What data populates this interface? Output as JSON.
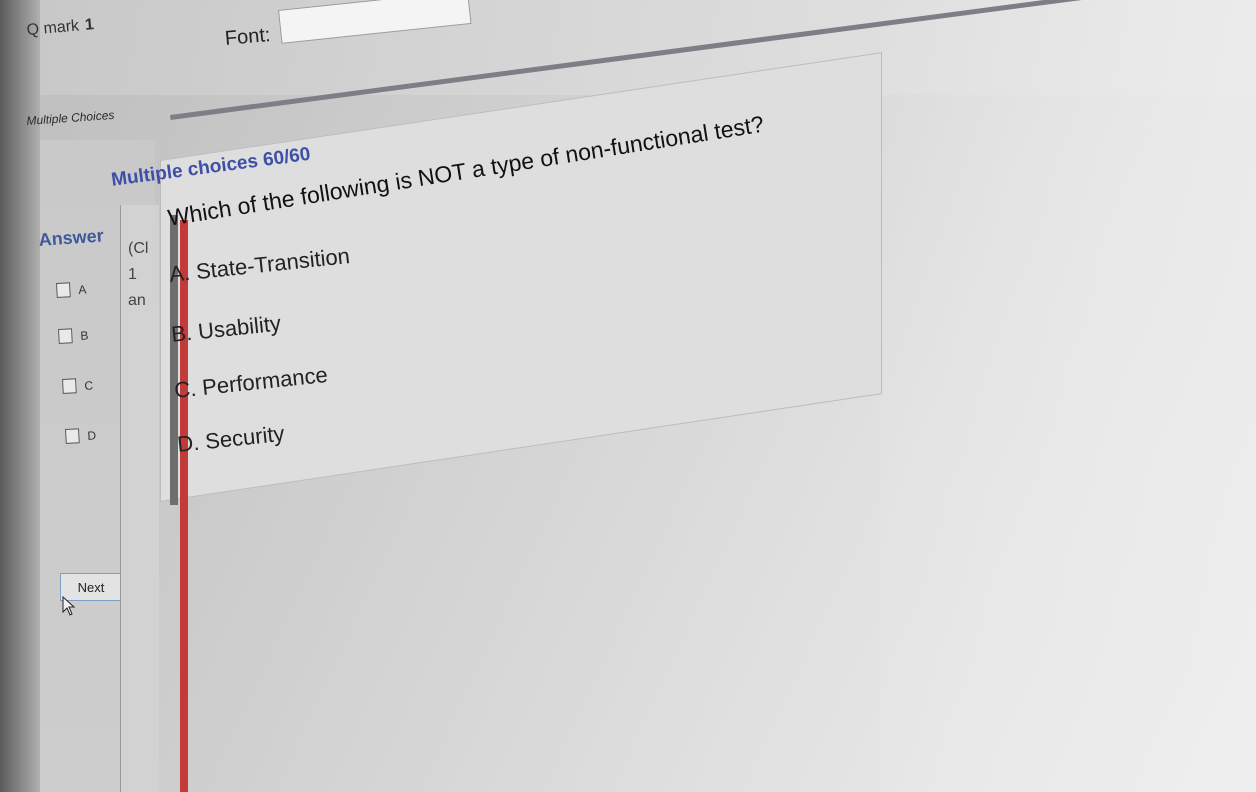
{
  "header": {
    "q_mark_label": "Q mark",
    "q_mark_value": "1",
    "font_label": "Font:",
    "font_value": ""
  },
  "section_tab": "Multiple Choices",
  "answer_panel": {
    "title": "Answer",
    "options": [
      "A",
      "B",
      "C",
      "D"
    ],
    "next_label": "Next"
  },
  "stub_text": [
    "(Cl",
    "1",
    "an"
  ],
  "question": {
    "heading": "Multiple choices 60/60",
    "text": "Which of the following is NOT a type of non-functional test?",
    "choices": [
      "A. State-Transition",
      "B. Usability",
      "C. Performance",
      "D. Security"
    ]
  }
}
